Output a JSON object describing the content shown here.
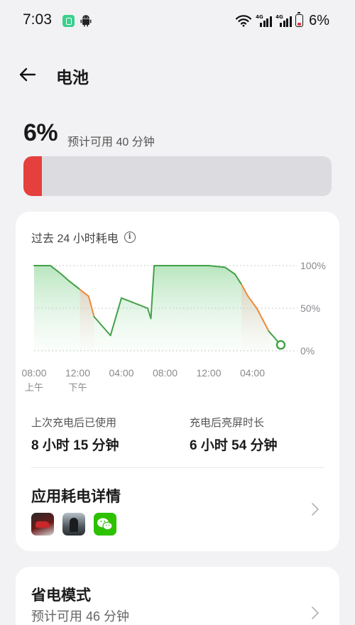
{
  "status_bar": {
    "time": "7:03",
    "battery_pct": "6%",
    "signal_labels": [
      "4G",
      "4G"
    ]
  },
  "header": {
    "title": "电池"
  },
  "battery": {
    "percent": "6%",
    "level": 0.06,
    "remaining": "预计可用 40 分钟",
    "fill_color": "#e5403e"
  },
  "usage_card": {
    "title": "过去 24 小时耗电",
    "stats": [
      {
        "label": "上次充电后已使用",
        "value": "8 小时 15 分钟"
      },
      {
        "label": "充电后亮屏时长",
        "value": "6 小时 54 分钟"
      }
    ],
    "apps_title": "应用耗电详情",
    "apps": [
      {
        "name": "racing-game",
        "icon": "racing-car-icon"
      },
      {
        "name": "shooter-game",
        "icon": "soldier-icon"
      },
      {
        "name": "wechat",
        "icon": "wechat-icon"
      }
    ]
  },
  "power_saver": {
    "title": "省电模式",
    "subtitle": "预计可用 46 分钟"
  },
  "chart_data": {
    "type": "area",
    "title": "过去 24 小时耗电",
    "y_tick_labels": [
      "100%",
      "50%",
      "0%"
    ],
    "ylim": [
      0,
      100
    ],
    "x_tick_labels": [
      "08:00",
      "12:00",
      "04:00",
      "08:00",
      "12:00",
      "04:00"
    ],
    "x_tick_sublabels": [
      "上午",
      "下午",
      "",
      "",
      "",
      ""
    ],
    "x_hours": [
      0,
      4,
      8,
      12,
      16,
      20
    ],
    "xlim": [
      0,
      24
    ],
    "grid": true,
    "line_color": "#43a047",
    "discharge_color": "#ef8a3a",
    "series": [
      {
        "x": [
          0,
          1.5,
          2.5,
          3.2,
          4.2,
          5.0,
          5.5,
          7.0,
          8.0,
          9.0,
          10.4,
          10.7,
          11.0,
          16.0,
          17.5,
          18.4,
          19.0,
          19.6,
          20.4,
          21.5,
          22.6
        ],
        "values": [
          100,
          100,
          90,
          82,
          72,
          64,
          40,
          18,
          62,
          57,
          50,
          38,
          100,
          100,
          98,
          90,
          78,
          64,
          50,
          23,
          7
        ]
      }
    ]
  }
}
